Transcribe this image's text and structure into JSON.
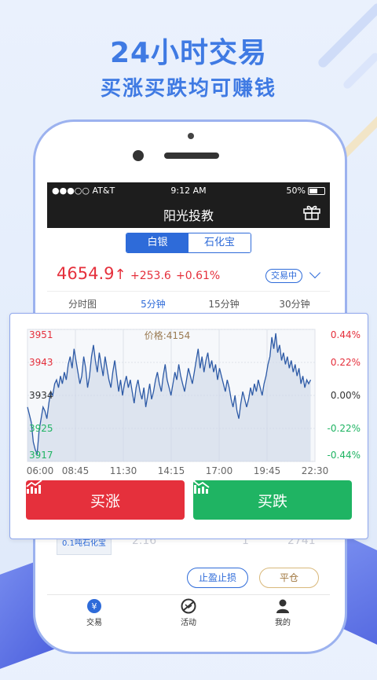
{
  "promo": {
    "headline": "24小时交易",
    "subline": "买涨买跌均可赚钱"
  },
  "status_bar": {
    "signal": "●●●○○ AT&T",
    "time": "9:12 AM",
    "battery": "50%"
  },
  "nav": {
    "title": "阳光投教"
  },
  "segment": {
    "options": [
      "白银",
      "石化宝"
    ],
    "selected": "白银"
  },
  "quote": {
    "price": "4654.9",
    "arrow": "↑",
    "change": "+253.6",
    "percent": "+0.61%",
    "status": "交易中"
  },
  "tabs": [
    "分时图",
    "5分钟",
    "15分钟",
    "30分钟"
  ],
  "active_tab": "5分钟",
  "chart_data": {
    "type": "line",
    "price_label": "价格:4154",
    "y_left_ticks": [
      "3951",
      "3943",
      "3934",
      "3925",
      "3917"
    ],
    "y_right_ticks": [
      "0.44%",
      "0.22%",
      "0.00%",
      "-0.22%",
      "-0.44%"
    ],
    "x_ticks": [
      "06:00",
      "08:45",
      "11:30",
      "14:15",
      "17:00",
      "19:45",
      "22:30"
    ],
    "ylim": [
      3917,
      3951
    ],
    "series": [
      {
        "values": [
          3931,
          3929,
          3927,
          3922,
          3920,
          3919,
          3925,
          3928,
          3931,
          3930,
          3928,
          3932,
          3935,
          3934,
          3937,
          3938,
          3936,
          3939,
          3937,
          3940,
          3938,
          3942,
          3944,
          3941,
          3946,
          3943,
          3940,
          3937,
          3939,
          3944,
          3941,
          3936,
          3939,
          3944,
          3947,
          3943,
          3940,
          3945,
          3942,
          3939,
          3944,
          3941,
          3938,
          3936,
          3940,
          3943,
          3939,
          3935,
          3938,
          3934,
          3937,
          3939,
          3936,
          3938,
          3935,
          3932,
          3936,
          3938,
          3935,
          3933,
          3936,
          3931,
          3934,
          3937,
          3933,
          3935,
          3938,
          3940,
          3937,
          3935,
          3939,
          3942,
          3938,
          3936,
          3934,
          3937,
          3940,
          3938,
          3942,
          3939,
          3937,
          3935,
          3938,
          3941,
          3939,
          3937,
          3940,
          3943,
          3946,
          3941,
          3944,
          3940,
          3943,
          3945,
          3941,
          3943,
          3940,
          3942,
          3938,
          3941,
          3939,
          3937,
          3935,
          3938,
          3936,
          3933,
          3931,
          3934,
          3930,
          3928,
          3932,
          3935,
          3933,
          3931,
          3933,
          3936,
          3934,
          3937,
          3935,
          3938,
          3936,
          3934,
          3937,
          3939,
          3942,
          3944,
          3949,
          3946,
          3950,
          3945,
          3947,
          3943,
          3945,
          3942,
          3944,
          3941,
          3943,
          3940,
          3942,
          3939,
          3941,
          3937,
          3939,
          3936,
          3938,
          3937,
          3938
        ]
      }
    ]
  },
  "actions": {
    "buy_up": "买涨",
    "buy_down": "买跌"
  },
  "behind": {
    "product": "0.1吨石化宝",
    "v1": "2.16",
    "v2": "1",
    "v3": "2741"
  },
  "order_buttons": {
    "stop": "止盈止损",
    "close": "平仓"
  },
  "tabbar": [
    {
      "label": "交易",
      "icon": "yen-icon"
    },
    {
      "label": "活动",
      "icon": "activity-icon"
    },
    {
      "label": "我的",
      "icon": "user-icon"
    }
  ],
  "colors": {
    "accent": "#2e6bd9",
    "up": "#e5303c",
    "down": "#1fb463",
    "headline": "#3f7ae3"
  }
}
